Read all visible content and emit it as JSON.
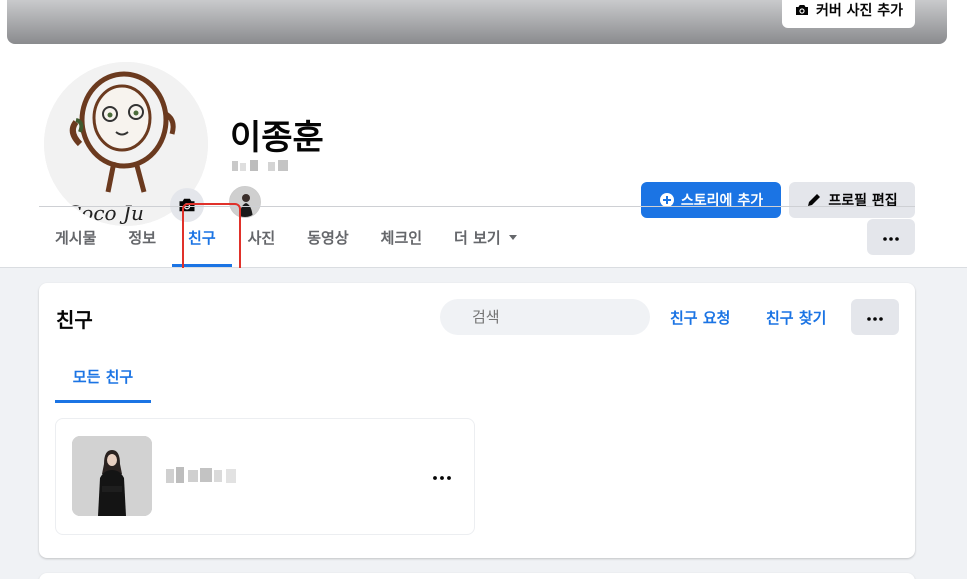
{
  "cover": {
    "add_photo_label": "커버 사진 추가"
  },
  "profile": {
    "name": "이종훈",
    "add_story_label": "스토리에 추가",
    "edit_profile_label": "프로필 편집"
  },
  "tabs": [
    {
      "label": "게시물"
    },
    {
      "label": "정보"
    },
    {
      "label": "친구"
    },
    {
      "label": "사진"
    },
    {
      "label": "동영상"
    },
    {
      "label": "체크인"
    },
    {
      "label": "더 보기"
    }
  ],
  "active_tab": "친구",
  "friends_section": {
    "title": "친구",
    "search_placeholder": "검색",
    "friend_requests_label": "친구 요청",
    "find_friends_label": "친구 찾기",
    "subtab_all": "모든 친구"
  },
  "colors": {
    "accent": "#1b74e4",
    "highlight_box": "#e0312a",
    "page_bg": "#f0f2f5"
  },
  "icons": {
    "camera": "camera-icon",
    "plus": "plus-circle-icon",
    "pencil": "pencil-icon",
    "more": "more-horizontal-icon",
    "search": "search-icon",
    "caret": "caret-down-icon"
  }
}
